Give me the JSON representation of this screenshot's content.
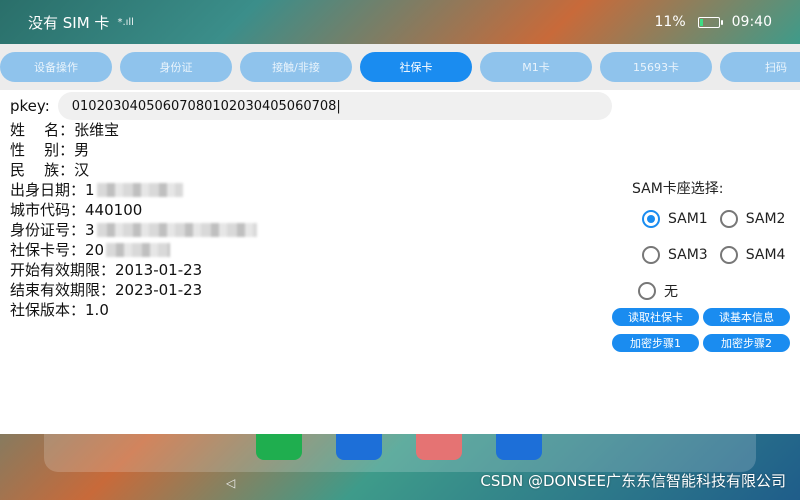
{
  "status_bar": {
    "carrier": "没有 SIM 卡",
    "battery_text": "11%",
    "time": "09:40"
  },
  "tabs": [
    {
      "label": "设备操作"
    },
    {
      "label": "身份证"
    },
    {
      "label": "接触/非接"
    },
    {
      "label": "社保卡",
      "active": true
    },
    {
      "label": "M1卡"
    },
    {
      "label": "15693卡"
    },
    {
      "label": "扫码"
    }
  ],
  "pkey": {
    "label": "pkey:",
    "value": "0102030405060708010203040506070​8"
  },
  "info": [
    {
      "label": "姓    名：",
      "value": "张维宝"
    },
    {
      "label": "性    别：",
      "value": "男"
    },
    {
      "label": "民    族：",
      "value": "汉"
    },
    {
      "label": "出身日期：",
      "value": "1"
    },
    {
      "label": "城市代码：",
      "value": "440100"
    },
    {
      "label": "身份证号：",
      "value": "3"
    },
    {
      "label": "社保卡号：",
      "value": "20"
    },
    {
      "label": "开始有效期限：",
      "value": "2013-01-23"
    },
    {
      "label": "结束有效期限：",
      "value": "2023-01-23"
    },
    {
      "label": "社保版本：",
      "value": "1.0"
    }
  ],
  "sam": {
    "title": "SAM卡座选择:",
    "options": [
      {
        "label": "SAM1",
        "checked": true
      },
      {
        "label": "SAM2",
        "checked": false
      },
      {
        "label": "SAM3",
        "checked": false
      },
      {
        "label": "SAM4",
        "checked": false
      },
      {
        "label": "无",
        "checked": false
      }
    ],
    "buttons": {
      "read_card": "读取社保卡",
      "read_basic": "读基本信息",
      "encrypt1": "加密步骤1",
      "encrypt2": "加密步骤2"
    }
  },
  "watermark": "CSDN @DONSEE广东东信智能科技有限公司",
  "colors": {
    "accent": "#1a8cf0",
    "tab_inactive": "#8fc3ec"
  }
}
